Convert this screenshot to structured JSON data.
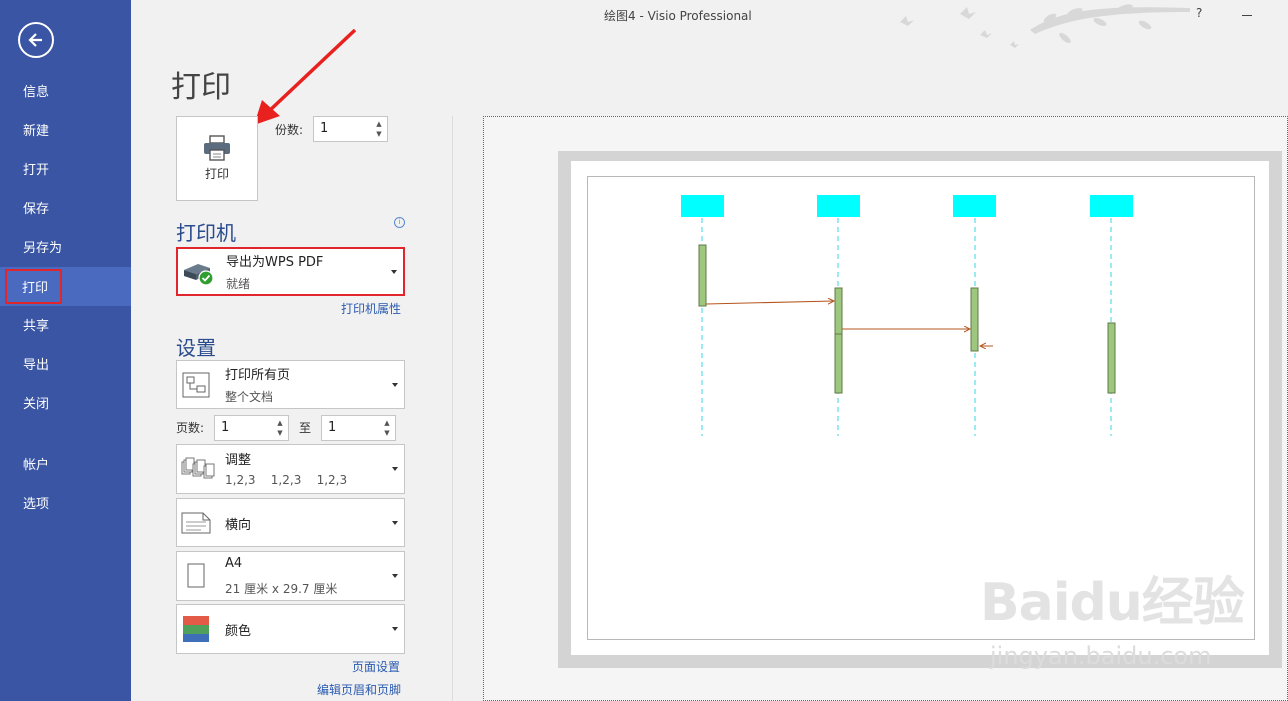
{
  "window": {
    "title": "绘图4 - Visio Professional",
    "help": "?"
  },
  "sidebar": {
    "items": [
      {
        "label": "信息"
      },
      {
        "label": "新建"
      },
      {
        "label": "打开"
      },
      {
        "label": "保存"
      },
      {
        "label": "另存为"
      },
      {
        "label": "打印"
      },
      {
        "label": "共享"
      },
      {
        "label": "导出"
      },
      {
        "label": "关闭"
      },
      {
        "label": "帐户"
      },
      {
        "label": "选项"
      }
    ],
    "active": "打印"
  },
  "print": {
    "title": "打印",
    "button_label": "打印",
    "copies_label": "份数:",
    "copies_value": "1"
  },
  "printer": {
    "section_title": "打印机",
    "name": "导出为WPS PDF",
    "status": "就绪",
    "properties_link": "打印机属性"
  },
  "settings": {
    "section_title": "设置",
    "pages_range": {
      "line1": "打印所有页",
      "line2": "整个文档"
    },
    "pages_label": "页数:",
    "page_from": "1",
    "to_label": "至",
    "page_to": "1",
    "collate": {
      "line1": "调整",
      "line2": "1,2,3    1,2,3    1,2,3"
    },
    "orientation": {
      "line1": "横向"
    },
    "paper": {
      "line1": "A4",
      "line2": "21 厘米 x 29.7 厘米"
    },
    "color": {
      "line1": "颜色"
    },
    "page_setup_link": "页面设置",
    "header_footer_link": "编辑页眉和页脚"
  },
  "colors": {
    "sidebar": "#3955a3",
    "lifeline_head": "#00ffff",
    "activation": "#9dc77e",
    "message": "#b5541c",
    "highlight": "#e0262c"
  },
  "watermark": {
    "brand": "Baidu经验",
    "url": "jingyan.baidu.com"
  }
}
